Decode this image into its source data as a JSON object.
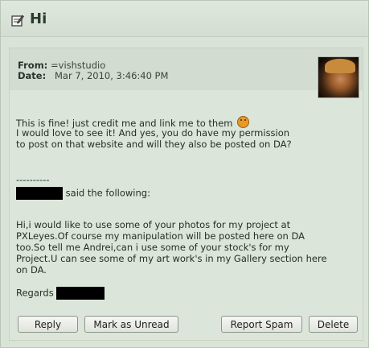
{
  "window": {
    "title": "Hi"
  },
  "message": {
    "from_label": "From:",
    "from_value": "=vishstudio",
    "date_label": "Date:",
    "date_value": "Mar 7, 2010, 3:46:40 PM",
    "lines": [
      "This is fine! just credit me and link me to them",
      "I would love to see it! And yes, you do have my permission",
      "to post on that website  and will they also be posted on DA?"
    ],
    "separator": "----------",
    "said_following": "said the following:",
    "quoted_lines": [
      "Hi,i would like to use some of your photos for my project at",
      "PXLeyes.Of course my manipulation will be posted here on DA",
      "too.So tell me Andrei,can i use some of your stock's for my",
      "Project.U can see some of my art work's in my Gallery section here",
      "on DA."
    ],
    "regards": "Regards"
  },
  "buttons": {
    "reply": "Reply",
    "mark_unread": "Mark as Unread",
    "report_spam": "Report Spam",
    "delete": "Delete"
  }
}
